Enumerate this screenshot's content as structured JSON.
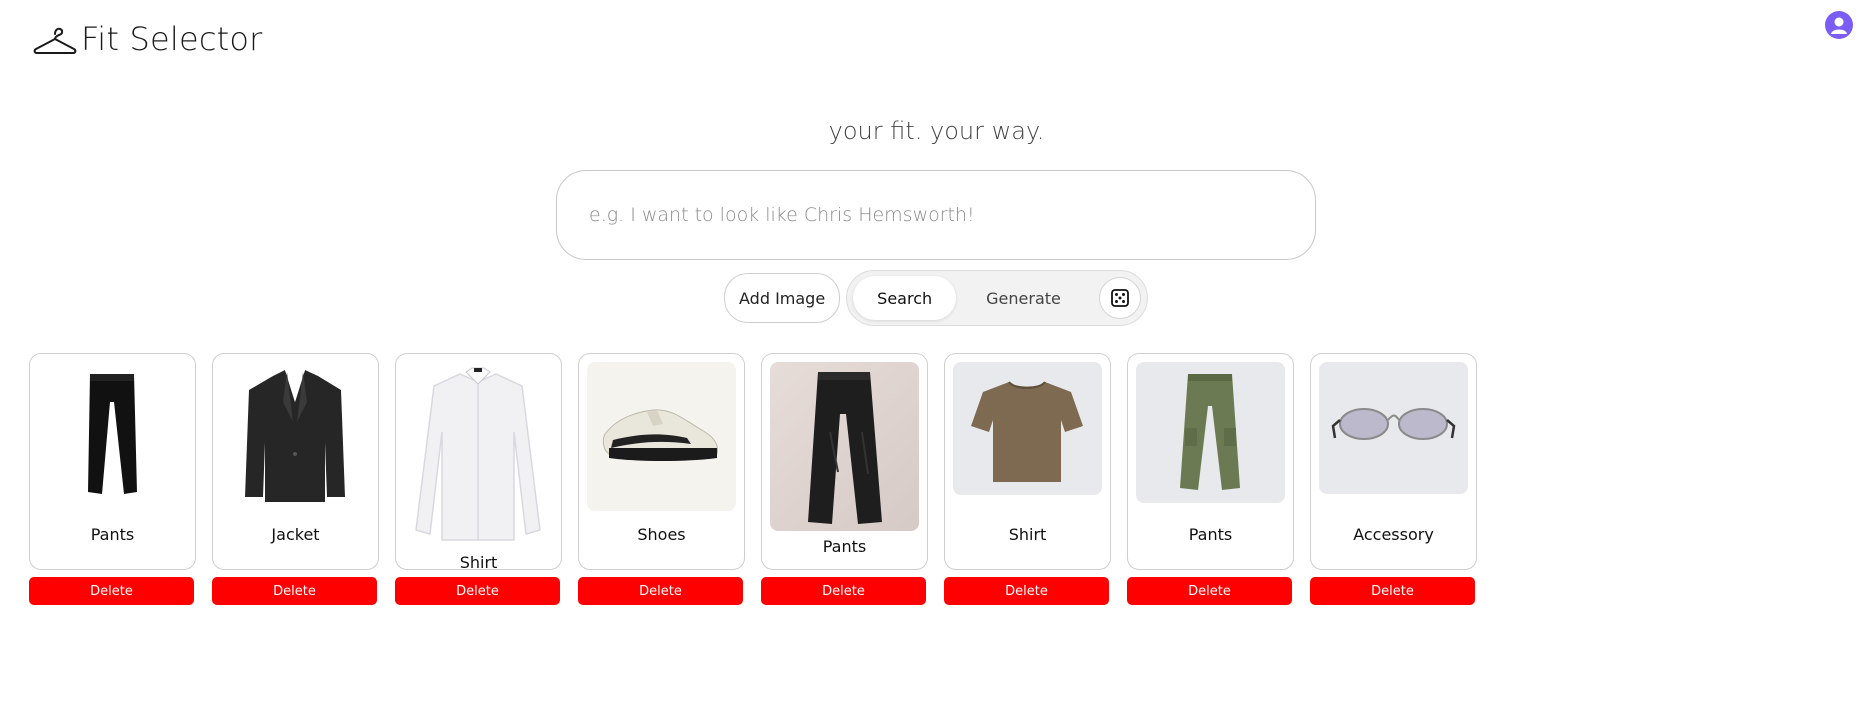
{
  "app": {
    "title": "Fit Selector"
  },
  "hero": {
    "tagline": "your fit. your way."
  },
  "search": {
    "placeholder": "e.g. I want to look like Chris Hemsworth!",
    "value": ""
  },
  "controls": {
    "add_image": "Add Image",
    "modes": [
      {
        "label": "Search",
        "active": true
      },
      {
        "label": "Generate",
        "active": false
      }
    ]
  },
  "colors": {
    "delete": "#ff0000",
    "avatar": "#7b5cf5"
  },
  "items": [
    {
      "label": "Pants",
      "delete_label": "Delete",
      "icon": "black-pants-image"
    },
    {
      "label": "Jacket",
      "delete_label": "Delete",
      "icon": "black-blazer-image"
    },
    {
      "label": "Shirt",
      "delete_label": "Delete",
      "icon": "white-dress-shirt-image"
    },
    {
      "label": "Shoes",
      "delete_label": "Delete",
      "icon": "salomon-sneaker-image"
    },
    {
      "label": "Pants",
      "delete_label": "Delete",
      "icon": "black-shell-pants-image"
    },
    {
      "label": "Shirt",
      "delete_label": "Delete",
      "icon": "brown-tshirt-image"
    },
    {
      "label": "Pants",
      "delete_label": "Delete",
      "icon": "olive-cargo-pants-image"
    },
    {
      "label": "Accessory",
      "delete_label": "Delete",
      "icon": "sunglasses-image"
    }
  ]
}
